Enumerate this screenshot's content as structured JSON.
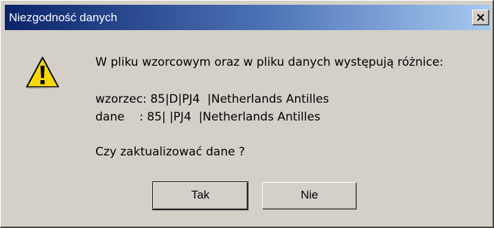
{
  "window": {
    "title": "Niezgodność danych"
  },
  "icons": {
    "warning": "warning-triangle",
    "close": "close-x"
  },
  "message": {
    "line1": "W pliku wzorcowym oraz w pliku danych występują różnice:",
    "line2": "wzorzec: 85|D|PJ4  |Netherlands Antilles",
    "line3": "dane    : 85| |PJ4  |Netherlands Antilles",
    "line4": "Czy zaktualizować dane ?"
  },
  "buttons": {
    "yes_label": "Tak",
    "no_label": "Nie"
  },
  "colors": {
    "title_bar_start": "#0a246a",
    "title_bar_end": "#a6caf0",
    "dialog_bg": "#d4d0c8",
    "warning_yellow": "#f5d800"
  }
}
